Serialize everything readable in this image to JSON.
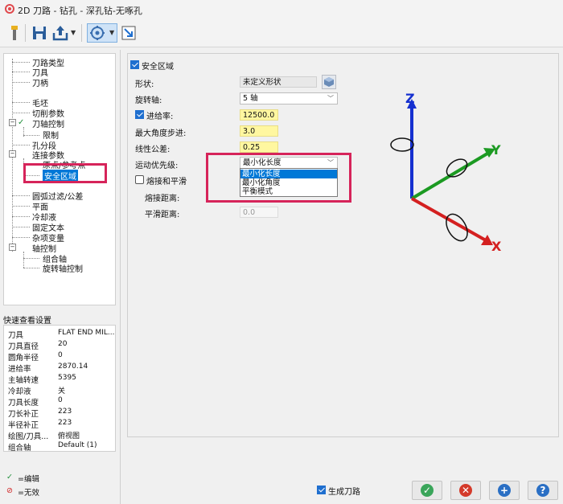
{
  "window": {
    "title": "2D 刀路 - 钻孔 - 深孔钻-无啄孔"
  },
  "toolbar": {
    "icons": [
      "tool-icon",
      "save-icon",
      "export-icon",
      "dropdown-arrow-icon",
      "view-icon",
      "dropdown-arrow-icon",
      "resize-icon"
    ]
  },
  "tree": {
    "items": [
      {
        "label": "刀路类型"
      },
      {
        "label": "刀具"
      },
      {
        "label": "刀柄"
      },
      {
        "label": "毛坯"
      },
      {
        "label": "切削参数"
      },
      {
        "label": "刀轴控制"
      },
      {
        "label": "限制"
      },
      {
        "label": "孔分段"
      },
      {
        "label": "连接参数"
      },
      {
        "label": "原点/参考点"
      },
      {
        "label": "安全区域"
      },
      {
        "label": "圆弧过滤/公差"
      },
      {
        "label": "平面"
      },
      {
        "label": "冷却液"
      },
      {
        "label": "固定文本"
      },
      {
        "label": "杂项变量"
      },
      {
        "label": "轴控制"
      },
      {
        "label": "组合轴"
      },
      {
        "label": "旋转轴控制"
      }
    ],
    "selected": "安全区域"
  },
  "quick_view": {
    "title": "快速查看设置",
    "rows": [
      {
        "key": "刀具",
        "value": "FLAT END MIL..."
      },
      {
        "key": "刀具直径",
        "value": "20"
      },
      {
        "key": "圆角半径",
        "value": "0"
      },
      {
        "key": "进给率",
        "value": "2870.14"
      },
      {
        "key": "主轴转速",
        "value": "5395"
      },
      {
        "key": "冷却液",
        "value": "关"
      },
      {
        "key": "刀具长度",
        "value": "0"
      },
      {
        "key": "刀长补正",
        "value": "223"
      },
      {
        "key": "半径补正",
        "value": "223"
      },
      {
        "key": "绘图/刀具...",
        "value": "俯视图"
      },
      {
        "key": "组合轴",
        "value": "Default (1)"
      }
    ]
  },
  "legend": {
    "edit": "=编辑",
    "invalid": "=无效"
  },
  "safety": {
    "group_label": "安全区域",
    "shape_label": "形状:",
    "shape_value": "未定义形状",
    "rotation_axis_label": "旋转轴:",
    "rotation_axis_value": "5 轴",
    "feed_label": "进给率:",
    "feed_value": "12500.0",
    "max_angle_label": "最大角度步进:",
    "max_angle_value": "3.0",
    "linear_tol_label": "线性公差:",
    "linear_tol_value": "0.25",
    "motion_priority_label": "运动优先级:",
    "motion_priority_value": "最小化长度",
    "motion_priority_options": [
      "最小化长度",
      "最小化角度",
      "平衡模式"
    ],
    "blend_label": "熔接和平滑",
    "blend_distance_label": "熔接距离:",
    "smooth_distance_label": "平滑距离:",
    "smooth_distance_value": "0.0"
  },
  "axes": {
    "z": "Z",
    "y": "Y",
    "x": "X",
    "colors": {
      "z": "#1530d0",
      "y": "#1c9a22",
      "x": "#d42020"
    }
  },
  "footer": {
    "generate_toolpath_label": "生成刀路"
  },
  "colors": {
    "highlight_box": "#d6245a",
    "selection": "#0078d7",
    "field_yellow": "#fff7a0"
  }
}
